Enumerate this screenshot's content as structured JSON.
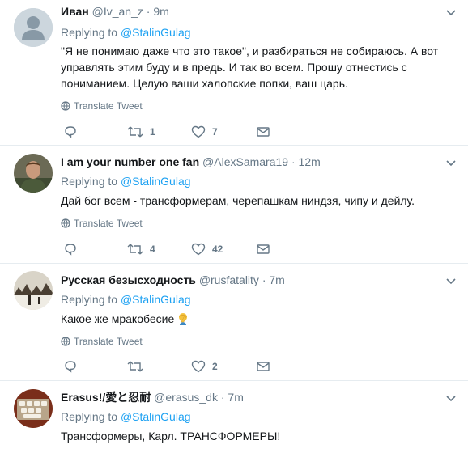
{
  "reply_prefix": "Replying to",
  "translate_label": "Translate Tweet",
  "colors": {
    "accent": "#1da1f2",
    "muted": "#657786",
    "text": "#14171a",
    "divider": "#e6ecf0"
  },
  "tweets": [
    {
      "name": "Иван",
      "handle": "@Iv_an_z",
      "dot": "·",
      "time": "9m",
      "reply_to": "@StalinGulag",
      "text": "\"Я не понимаю даже что это такое\", и разбираться не собираюсь. А вот управлять этим буду и в предь. И так во всем. Прошу отнестись с пониманием. Целую ваши халопские попки, ваш царь.",
      "retweets": "1",
      "likes": "7",
      "avatar": "default-egg-avatar"
    },
    {
      "name": "I am your number one fan",
      "handle": "@AlexSamara19",
      "dot": "·",
      "time": "12m",
      "reply_to": "@StalinGulag",
      "text": "Дай бог всем - трансформерам, черепашкам ниндзя, чипу и дейлу.",
      "retweets": "4",
      "likes": "42",
      "avatar": "man-in-uniform-photo"
    },
    {
      "name": "Русская безысходность",
      "handle": "@rusfatality",
      "dot": "·",
      "time": "7m",
      "reply_to": "@StalinGulag",
      "text": "Какое же мракобесие",
      "retweets": "",
      "likes": "2",
      "avatar": "winter-village-photo",
      "emoji": "facepalm-emoji"
    },
    {
      "name": "Erasus!/愛と忍耐",
      "handle": "@erasus_dk",
      "dot": "·",
      "time": "7m",
      "reply_to": "@StalinGulag",
      "text": "Трансформеры, Карл. ТРАНСФОРМЕРЫ!",
      "avatar": "keyboard-photo"
    }
  ]
}
